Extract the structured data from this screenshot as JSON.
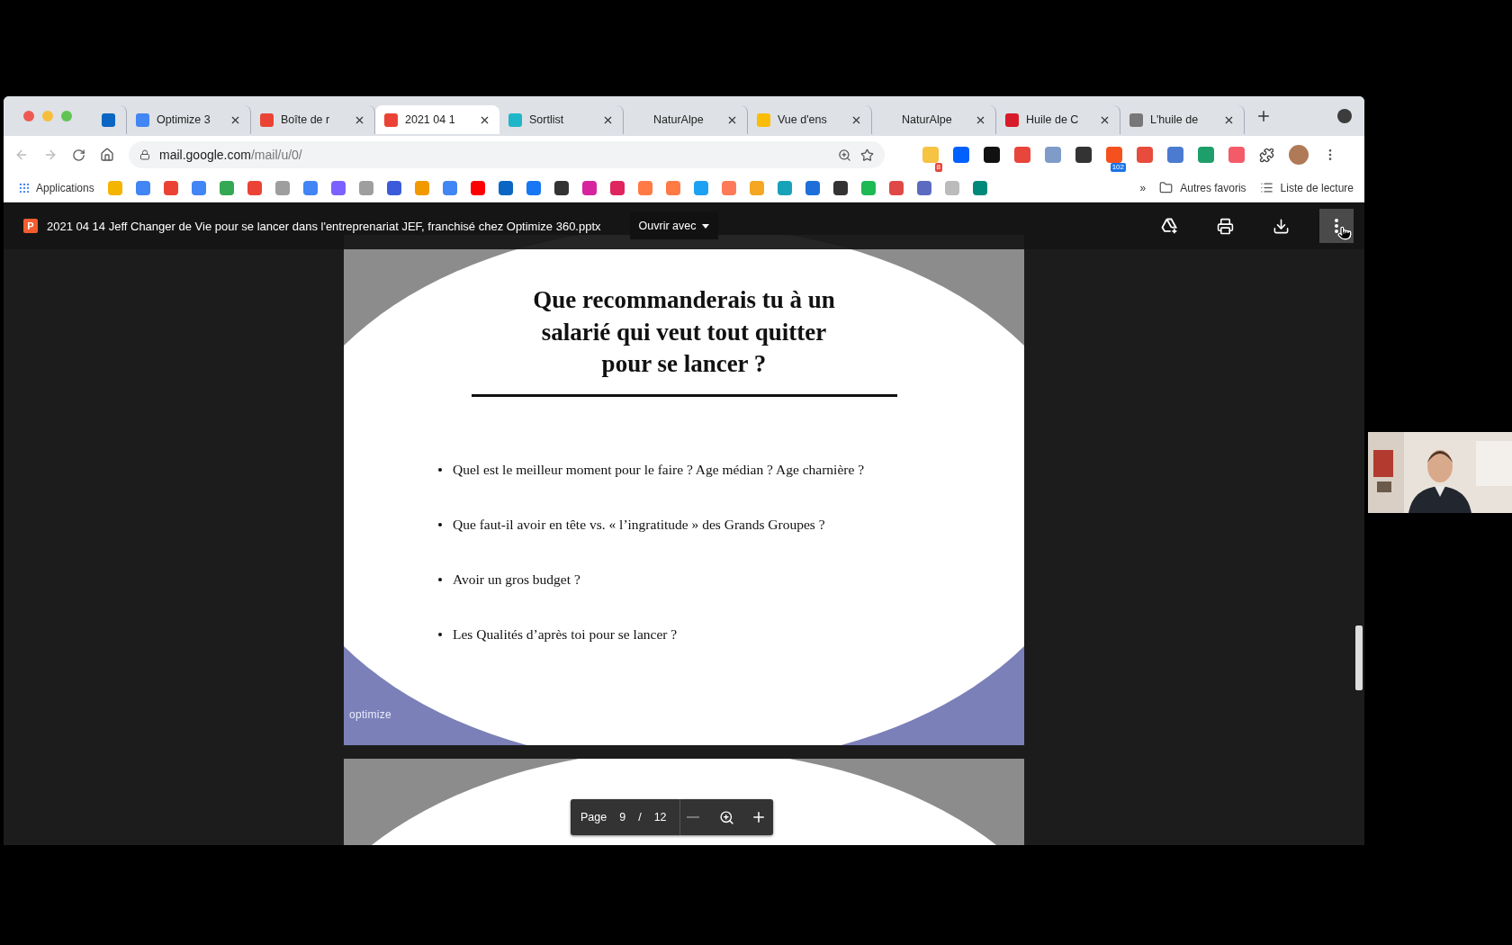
{
  "browser": {
    "tabs": [
      {
        "kind": "pinned",
        "color": "#0a66c2",
        "selected": false
      },
      {
        "kind": "tab",
        "title": "Optimize 3",
        "color": "#4285f4",
        "selected": false
      },
      {
        "kind": "tab",
        "title": "Boîte de r",
        "color": "#ea4335",
        "selected": false
      },
      {
        "kind": "tab",
        "title": "2021 04 1",
        "color": "#ea4335",
        "selected": true
      },
      {
        "kind": "tab",
        "title": "Sortlist",
        "color": "#1fb6c9",
        "selected": false
      },
      {
        "kind": "tab",
        "title": "NaturAlpe",
        "selected": false
      },
      {
        "kind": "tab",
        "title": "Vue d'ens",
        "color": "#fbbc04",
        "selected": false
      },
      {
        "kind": "tab",
        "title": "NaturAlpe",
        "selected": false
      },
      {
        "kind": "tab",
        "title": "Huile de C",
        "color": "#d81b2a",
        "selected": false
      },
      {
        "kind": "tab",
        "title": "L'huile de",
        "color": "#777777",
        "selected": false
      }
    ],
    "address": {
      "host": "mail.google.com",
      "path": "/mail/u/0/"
    },
    "extensions": [
      {
        "color": "#f6c343",
        "badge": "8"
      },
      {
        "color": "#0061ff"
      },
      {
        "color": "#111111"
      },
      {
        "color": "#e8453c"
      },
      {
        "color": "#7f9cc9"
      },
      {
        "color": "#333333"
      },
      {
        "color": "#f4511e",
        "badge": "102"
      },
      {
        "color": "#e74c3c"
      },
      {
        "color": "#4a7bd0"
      },
      {
        "color": "#1e9e6a"
      },
      {
        "color": "#f45b69"
      }
    ],
    "apps_label": "Applications",
    "bookmarks": [
      {
        "color": "#f4b400"
      },
      {
        "color": "#4285f4"
      },
      {
        "color": "#ea4335"
      },
      {
        "color": "#4285f4"
      },
      {
        "color": "#34a853"
      },
      {
        "color": "#ea4335"
      },
      {
        "color": "#9e9e9e"
      },
      {
        "color": "#4285f4"
      },
      {
        "color": "#7b61ff"
      },
      {
        "color": "#9e9e9e"
      },
      {
        "color": "#3b5bdb"
      },
      {
        "color": "#f29900"
      },
      {
        "color": "#4285f4"
      },
      {
        "color": "#ff0000"
      },
      {
        "color": "#0a66c2"
      },
      {
        "color": "#1877f2"
      },
      {
        "color": "#333333"
      },
      {
        "color": "#d6249f"
      },
      {
        "color": "#e0245e"
      },
      {
        "color": "#ff7a45"
      },
      {
        "color": "#ff7a45"
      },
      {
        "color": "#1da1f2"
      },
      {
        "color": "#ff7a59"
      },
      {
        "color": "#f5a623"
      },
      {
        "color": "#17a2b8"
      },
      {
        "color": "#1e6fd9"
      },
      {
        "color": "#333333"
      },
      {
        "color": "#1db954"
      },
      {
        "color": "#e04848"
      },
      {
        "color": "#5c6bc0"
      },
      {
        "color": "#bbbbbb"
      },
      {
        "color": "#00897b"
      }
    ],
    "overflow": "»",
    "other_bookmarks": "Autres favoris",
    "reading_list": "Liste de lecture"
  },
  "viewer": {
    "file_icon": "P",
    "filename": "2021 04 14 Jeff Changer de Vie pour se lancer dans l'entreprenariat JEF, franchisé chez Optimize 360.pptx",
    "open_with": "Ouvrir avec",
    "slide": {
      "title_lines": [
        "Que recommanderais tu à un",
        "salarié qui veut tout quitter",
        "pour se lancer ?"
      ],
      "bullets": [
        "Quel est le meilleur moment pour le faire ? Age médian ? Age charnière ?",
        "Que faut-il avoir en tête vs. « l’ingratitude » des Grands Groupes ?",
        "Avoir un gros budget ?",
        "Les Qualités d’après toi pour se lancer ?"
      ],
      "logo": "optimize"
    },
    "pager": {
      "label": "Page",
      "current": "9",
      "separator": "/",
      "total": "12"
    }
  }
}
